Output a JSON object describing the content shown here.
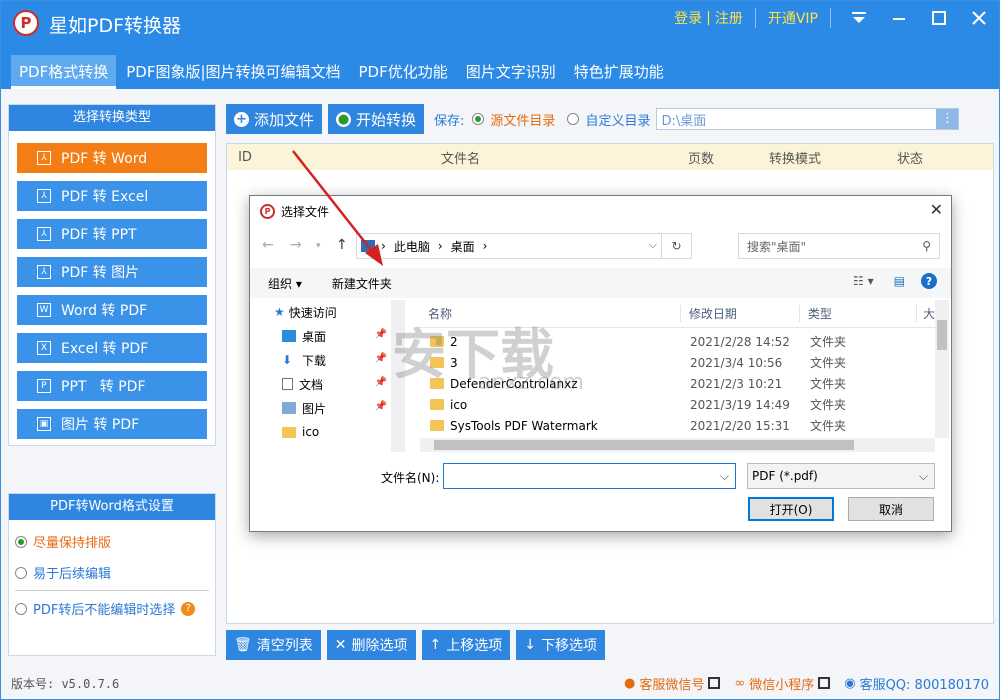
{
  "app": {
    "title": "星如PDF转换器",
    "logo": "P"
  },
  "titlebar": {
    "login": "登录",
    "separator": "|",
    "register": "注册",
    "vip": "开通VIP"
  },
  "tabs": [
    {
      "label": "PDF格式转换"
    },
    {
      "label": "PDF图象版|图片转换可编辑文档"
    },
    {
      "label": "PDF优化功能"
    },
    {
      "label": "图片文字识别"
    },
    {
      "label": "特色扩展功能"
    }
  ],
  "left_panel": {
    "header": "选择转换类型",
    "items": [
      {
        "label": "PDF 转 Word",
        "icon": "pdf-icon",
        "glyph": "⅄"
      },
      {
        "label": "PDF 转 Excel",
        "icon": "pdf-icon",
        "glyph": "⅄"
      },
      {
        "label": "PDF 转 PPT",
        "icon": "pdf-icon",
        "glyph": "⅄"
      },
      {
        "label": "PDF 转 图片",
        "icon": "pdf-icon",
        "glyph": "⅄"
      },
      {
        "label": "Word 转 PDF",
        "icon": "word-icon",
        "glyph": "W"
      },
      {
        "label": "Excel 转 PDF",
        "icon": "excel-icon",
        "glyph": "X"
      },
      {
        "label": "PPT   转 PDF",
        "icon": "ppt-icon",
        "glyph": "P"
      },
      {
        "label": "图片 转 PDF",
        "icon": "image-icon",
        "glyph": "▣"
      }
    ]
  },
  "settings": {
    "header": "PDF转Word格式设置",
    "opt1": "尽量保持排版",
    "opt2": "易于后续编辑",
    "opt3": "PDF转后不能编辑时选择",
    "help": "?"
  },
  "toolbar": {
    "add_file": "添加文件",
    "start": "开始转换",
    "save_label": "保存:",
    "save_source": "源文件目录",
    "save_custom": "自定义目录",
    "path": "D:\\桌面",
    "path_btn": "⋮"
  },
  "table": {
    "columns": [
      "ID",
      "文件名",
      "页数",
      "转换模式",
      "状态"
    ]
  },
  "bottom_buttons": {
    "clear": "清空列表",
    "delete": "删除选项",
    "up": "上移选项",
    "down": "下移选项"
  },
  "status": {
    "version": "版本号: v5.0.7.6",
    "wechat": "客服微信号",
    "miniprogram": "微信小程序",
    "qq": "客服QQ: 800180170"
  },
  "dialog": {
    "title": "选择文件",
    "address": [
      "此电脑",
      "桌面"
    ],
    "search_placeholder": "搜索\"桌面\"",
    "organize": "组织 ▾",
    "new_folder": "新建文件夹",
    "nav": [
      {
        "label": "快速访问",
        "pinned": false
      },
      {
        "label": "桌面",
        "pinned": true
      },
      {
        "label": "下载",
        "pinned": true
      },
      {
        "label": "文档",
        "pinned": true
      },
      {
        "label": "图片",
        "pinned": true
      },
      {
        "label": "ico",
        "pinned": false
      }
    ],
    "columns": {
      "name": "名称",
      "date": "修改日期",
      "type": "类型",
      "more": "大"
    },
    "files": [
      {
        "name": "2",
        "date": "2021/2/28 14:52",
        "type": "文件夹"
      },
      {
        "name": "3",
        "date": "2021/3/4 10:56",
        "type": "文件夹"
      },
      {
        "name": "DefenderControlanxz",
        "date": "2021/2/3 10:21",
        "type": "文件夹"
      },
      {
        "name": "ico",
        "date": "2021/3/19 14:49",
        "type": "文件夹"
      },
      {
        "name": "SysTools PDF Watermark",
        "date": "2021/2/20 15:31",
        "type": "文件夹"
      }
    ],
    "filename_label": "文件名(N):",
    "filename_value": "",
    "filetype": "PDF (*.pdf)",
    "open": "打开(O)",
    "cancel": "取消"
  },
  "watermark": {
    "text": "安下载",
    "url": "anxz.com"
  },
  "colors": {
    "brand": "#2b8ae6",
    "active": "#f57d16",
    "vip": "#ffe14a"
  }
}
